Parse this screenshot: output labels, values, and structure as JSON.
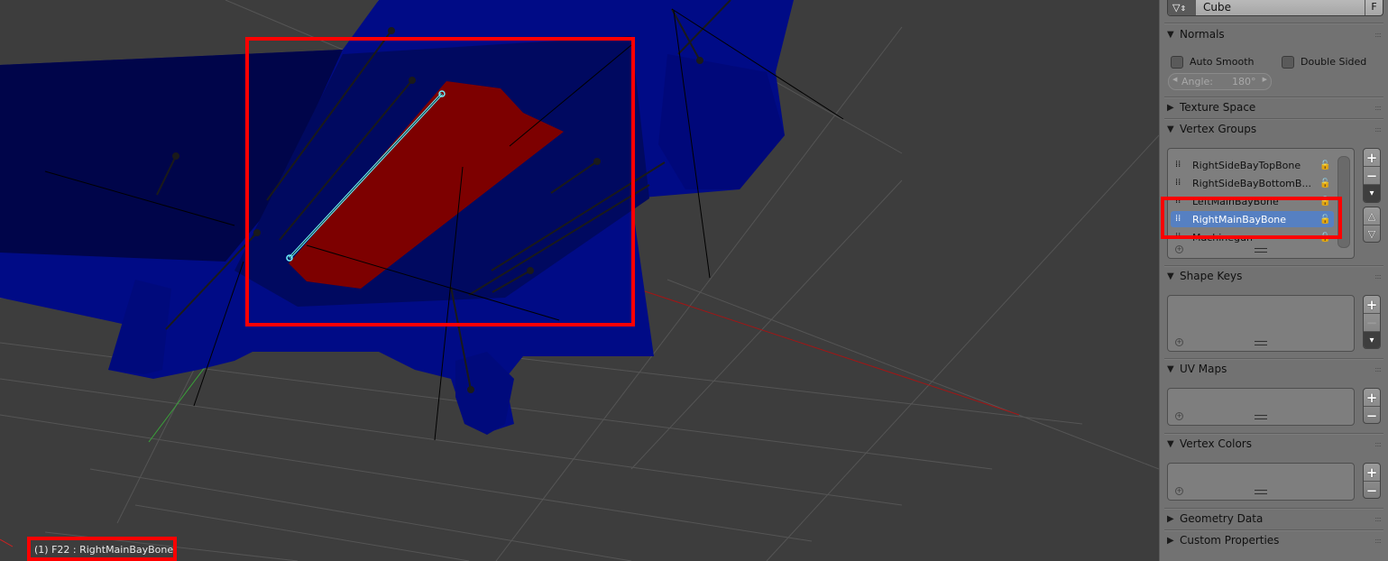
{
  "viewport": {
    "status_text": "(1) F22 : RightMainBayBone",
    "colors": {
      "background": "#3d3d3d",
      "mesh_blue": "#000b86",
      "mesh_dark_blue": "#00054a",
      "selected_face": "#7d0000",
      "selected_bone": "#6ff3ff",
      "highlight_box": "#ff0000",
      "grid": "#555555"
    }
  },
  "panel": {
    "mesh_selector": {
      "icon": "mesh-data-icon",
      "name": "Cube",
      "fake_user_label": "F"
    },
    "normals": {
      "title": "Normals",
      "expanded": true,
      "auto_smooth_label": "Auto Smooth",
      "auto_smooth_checked": false,
      "double_sided_label": "Double Sided",
      "double_sided_checked": false,
      "angle_label": "Angle:",
      "angle_value": "180°"
    },
    "texture_space": {
      "title": "Texture Space",
      "expanded": false
    },
    "vertex_groups": {
      "title": "Vertex Groups",
      "expanded": true,
      "items": [
        {
          "name": "RightSideBayTopBone",
          "selected": false
        },
        {
          "name": "RightSideBayBottomB...",
          "selected": false
        },
        {
          "name": "LeftMainBayBone",
          "selected": false
        },
        {
          "name": "RightMainBayBone",
          "selected": true
        },
        {
          "name": "Machinegun",
          "selected": false
        }
      ]
    },
    "shape_keys": {
      "title": "Shape Keys",
      "expanded": true
    },
    "uv_maps": {
      "title": "UV Maps",
      "expanded": true
    },
    "vertex_colors": {
      "title": "Vertex Colors",
      "expanded": true
    },
    "geometry_data": {
      "title": "Geometry Data",
      "expanded": false
    },
    "custom_properties": {
      "title": "Custom Properties",
      "expanded": false
    },
    "icons": {
      "expanded": "▼",
      "collapsed": "▶",
      "grip": "::::",
      "add": "+",
      "remove": "−",
      "specials": "▾",
      "move_up": "△",
      "move_down": "▽",
      "group": "⁞⁞",
      "lock": "🔓"
    }
  }
}
